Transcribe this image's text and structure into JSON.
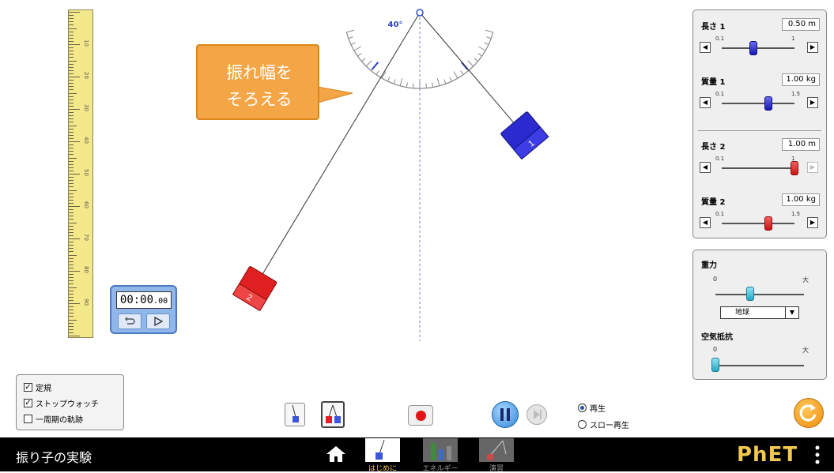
{
  "sim": {
    "angle_label": "40°",
    "callout_lines": [
      "振れ幅を",
      "そろえる"
    ],
    "pendulum_labels": {
      "blue": "1",
      "red": "2"
    }
  },
  "ruler": {
    "labels": [
      "10",
      "20",
      "30",
      "40",
      "50",
      "60",
      "70",
      "80",
      "90"
    ]
  },
  "stopwatch": {
    "time_main": "00:00",
    "time_fraction": ".00"
  },
  "controls": {
    "length1": {
      "label": "長さ 1",
      "value": "0.50 m",
      "min": "0.1",
      "max": "1",
      "fraction": 0.44
    },
    "mass1": {
      "label": "質量 1",
      "value": "1.00 kg",
      "min": "0.1",
      "max": "1.5",
      "fraction": 0.64
    },
    "length2": {
      "label": "長さ 2",
      "value": "1.00 m",
      "min": "0.1",
      "max": "1",
      "fraction": 1.0
    },
    "mass2": {
      "label": "質量 2",
      "value": "1.00 kg",
      "min": "0.1",
      "max": "1.5",
      "fraction": 0.64
    }
  },
  "environment": {
    "gravity_label": "重力",
    "gravity_min": "0",
    "gravity_max": "大",
    "gravity_fraction": 0.39,
    "planet_selected": "地球",
    "friction_label": "空気抵抗",
    "friction_min": "0",
    "friction_max": "大",
    "friction_fraction": 0.0
  },
  "checkboxes": [
    {
      "label": "定規",
      "checked": true
    },
    {
      "label": "ストップウォッチ",
      "checked": true
    },
    {
      "label": "一周期の軌跡",
      "checked": false
    }
  ],
  "playback": {
    "normal": "再生",
    "slow": "スロー再生",
    "selected": "normal"
  },
  "navbar": {
    "title": "振り子の実験",
    "screens": [
      "はじめに",
      "エネルギー",
      "演習"
    ],
    "brand": "PhET"
  },
  "colors": {
    "accent_orange": "#f4a546",
    "pendulum1": "#2a2acf",
    "pendulum2": "#e02020",
    "brand": "#f2c94c"
  }
}
